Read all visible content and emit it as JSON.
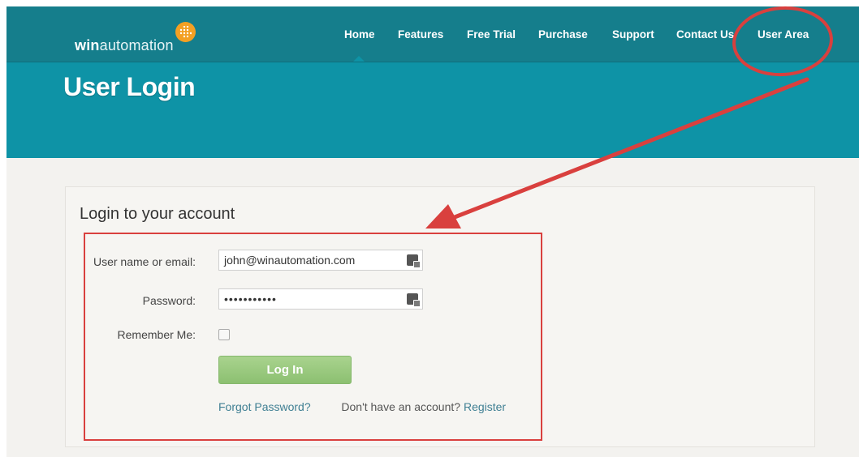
{
  "brand": {
    "logo_bold": "win",
    "logo_rest": "automation"
  },
  "nav": {
    "items": [
      {
        "label": "Home"
      },
      {
        "label": "Features"
      },
      {
        "label": "Free Trial"
      },
      {
        "label": "Purchase"
      },
      {
        "label": "Support"
      },
      {
        "label": "Contact Us"
      },
      {
        "label": "User Area"
      }
    ]
  },
  "hero": {
    "title": "User Login"
  },
  "login": {
    "heading": "Login to your account",
    "username_label": "User name or email:",
    "username_value": "john@winautomation.com",
    "password_label": "Password:",
    "password_value": "•••••••••••",
    "remember_label": "Remember Me:",
    "submit_label": "Log In",
    "forgot_link": "Forgot Password?",
    "no_account_text": "Don't have an account?",
    "register_link": "Register"
  },
  "colors": {
    "topbar": "#157e8c",
    "hero": "#0e93a6",
    "accent_orange": "#f3a023",
    "button_green": "#9bc97f",
    "annotation_red": "#d9403e",
    "link": "#3f7f93"
  },
  "icons": {
    "logo_mark": "dot-grid-icon",
    "field_icon": "password-manager-key-icon"
  }
}
